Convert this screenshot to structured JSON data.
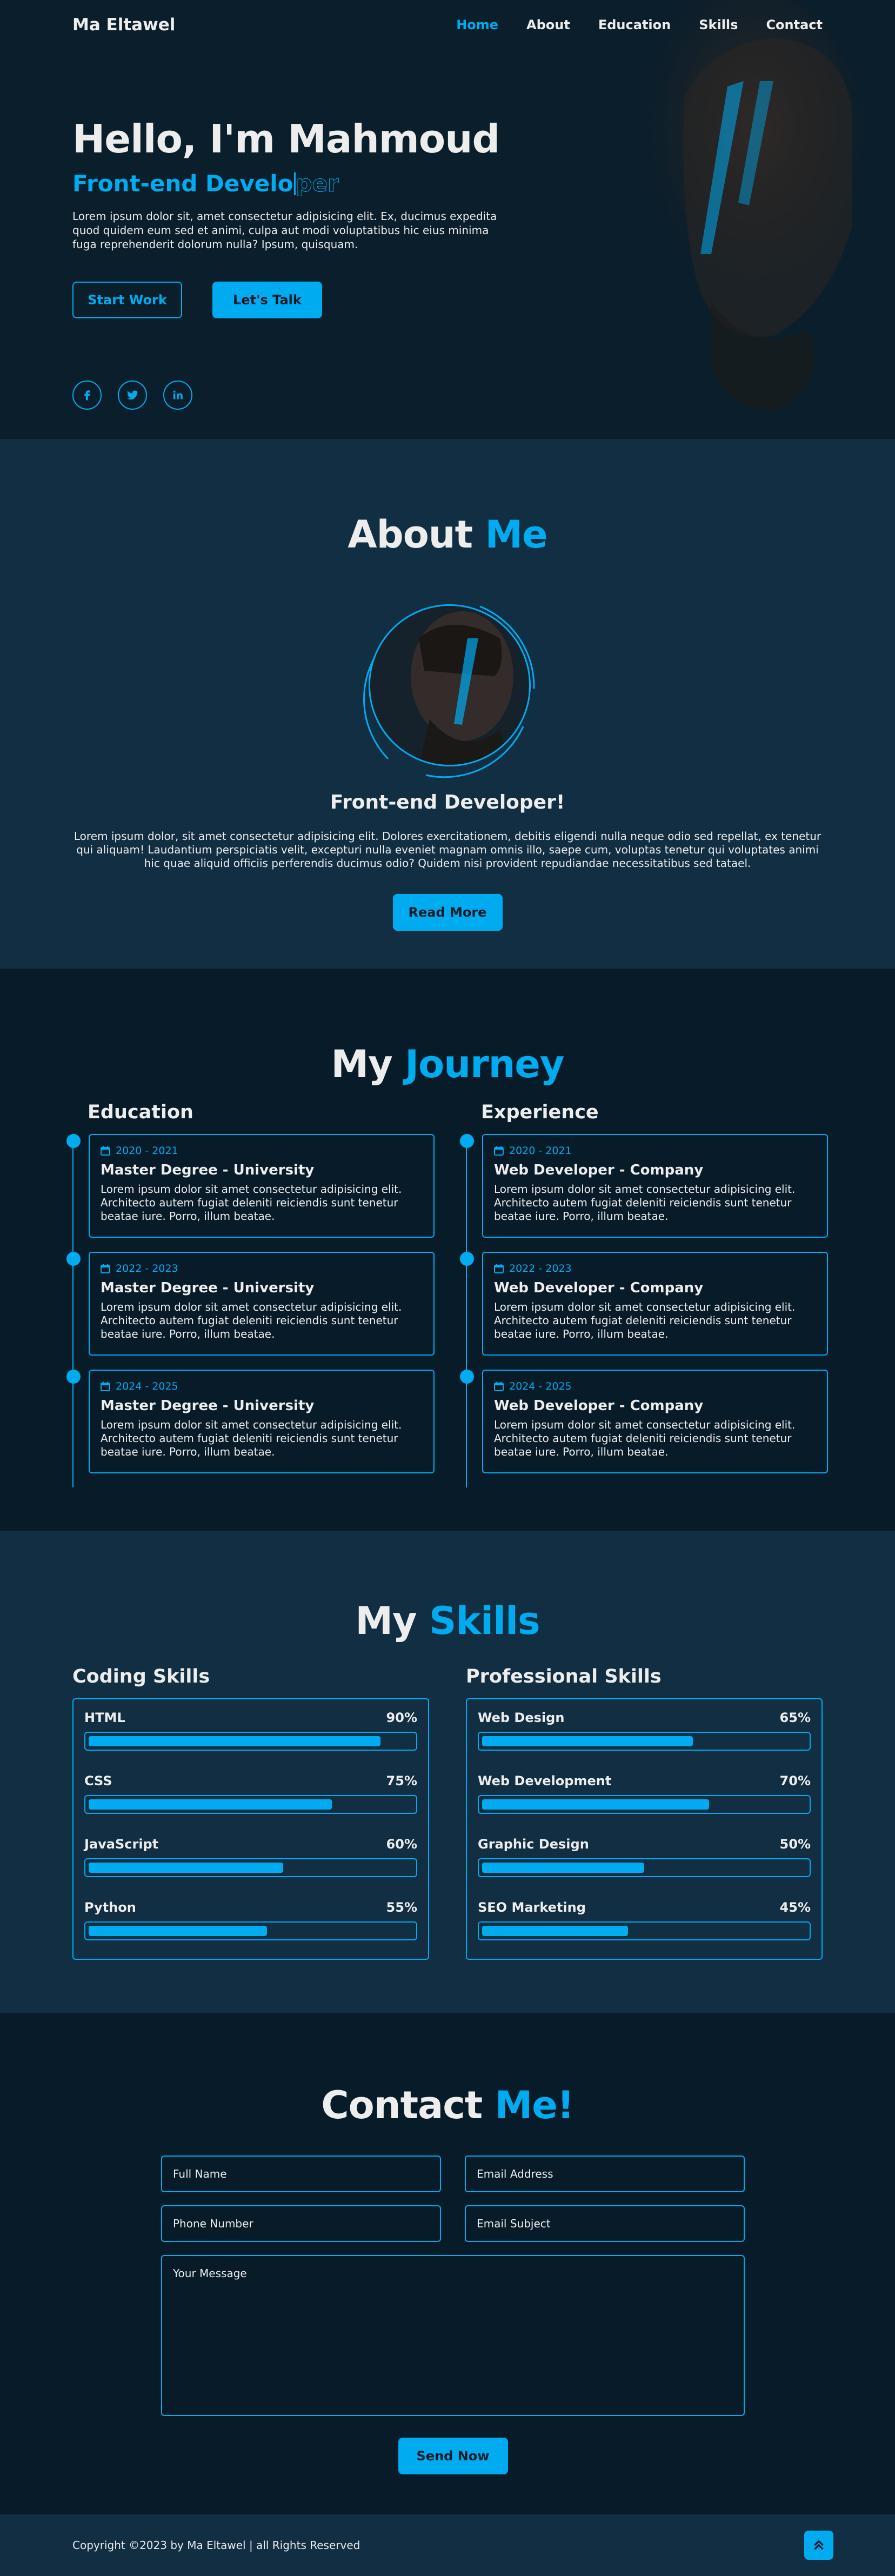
{
  "header": {
    "logo": "Ma Eltawel",
    "nav": [
      "Home",
      "About",
      "Education",
      "Skills",
      "Contact"
    ]
  },
  "hero": {
    "title": "Hello, I'm Mahmoud",
    "subtitle_typed": "Front-end Develo",
    "subtitle_rest": "per",
    "text": "Lorem ipsum dolor sit, amet consectetur adipisicing elit. Ex, ducimus expedita quod quidem eum sed et animi, culpa aut modi voluptatibus hic eius minima fuga reprehenderit dolorum nulla? Ipsum, quisquam.",
    "btn_primary": "Start Work",
    "btn_secondary": "Let's Talk",
    "socials": [
      "facebook-icon",
      "twitter-icon",
      "linkedin-icon"
    ]
  },
  "about": {
    "heading": "About",
    "heading_accent": "Me",
    "role": "Front-end Developer!",
    "text": "Lorem ipsum dolor, sit amet consectetur adipisicing elit. Dolores exercitationem, debitis eligendi nulla neque odio sed repellat, ex tenetur qui aliquam! Laudantium perspiciatis velit, excepturi nulla eveniet magnam omnis illo, saepe cum, voluptas tenetur qui voluptates animi hic quae aliquid officiis perferendis ducimus odio? Quidem nisi provident repudiandae necessitatibus sed tatael.",
    "button": "Read More"
  },
  "journey": {
    "heading": "My",
    "heading_accent": "Journey",
    "education": {
      "title": "Education",
      "items": [
        {
          "date": "2020 - 2021",
          "title": "Master Degree - University",
          "text": "Lorem ipsum dolor sit amet consectetur adipisicing elit. Architecto autem fugiat deleniti reiciendis sunt tenetur beatae iure. Porro, illum beatae."
        },
        {
          "date": "2022 - 2023",
          "title": "Master Degree - University",
          "text": "Lorem ipsum dolor sit amet consectetur adipisicing elit. Architecto autem fugiat deleniti reiciendis sunt tenetur beatae iure. Porro, illum beatae."
        },
        {
          "date": "2024 - 2025",
          "title": "Master Degree - University",
          "text": "Lorem ipsum dolor sit amet consectetur adipisicing elit. Architecto autem fugiat deleniti reiciendis sunt tenetur beatae iure. Porro, illum beatae."
        }
      ]
    },
    "experience": {
      "title": "Experience",
      "items": [
        {
          "date": "2020 - 2021",
          "title": "Web Developer - Company",
          "text": "Lorem ipsum dolor sit amet consectetur adipisicing elit. Architecto autem fugiat deleniti reiciendis sunt tenetur beatae iure. Porro, illum beatae."
        },
        {
          "date": "2022 - 2023",
          "title": "Web Developer - Company",
          "text": "Lorem ipsum dolor sit amet consectetur adipisicing elit. Architecto autem fugiat deleniti reiciendis sunt tenetur beatae iure. Porro, illum beatae."
        },
        {
          "date": "2024 - 2025",
          "title": "Web Developer - Company",
          "text": "Lorem ipsum dolor sit amet consectetur adipisicing elit. Architecto autem fugiat deleniti reiciendis sunt tenetur beatae iure. Porro, illum beatae."
        }
      ]
    }
  },
  "skills": {
    "heading": "My",
    "heading_accent": "Skills",
    "coding": {
      "title": "Coding Skills",
      "items": [
        {
          "name": "HTML",
          "value": "90%",
          "fraction": 0.9
        },
        {
          "name": "CSS",
          "value": "75%",
          "fraction": 0.75
        },
        {
          "name": "JavaScript",
          "value": "60%",
          "fraction": 0.6
        },
        {
          "name": "Python",
          "value": "55%",
          "fraction": 0.55
        }
      ]
    },
    "professional": {
      "title": "Professional Skills",
      "items": [
        {
          "name": "Web Design",
          "value": "65%",
          "fraction": 0.65
        },
        {
          "name": "Web Development",
          "value": "70%",
          "fraction": 0.7
        },
        {
          "name": "Graphic Design",
          "value": "50%",
          "fraction": 0.5
        },
        {
          "name": "SEO Marketing",
          "value": "45%",
          "fraction": 0.45
        }
      ]
    }
  },
  "contact": {
    "heading": "Contact",
    "heading_accent": "Me!",
    "full_name": "Full Name",
    "email": "Email Address",
    "phone": "Phone Number",
    "subject": "Email Subject",
    "message": "Your Message",
    "button": "Send Now"
  },
  "footer": {
    "copyright": "Copyright ©2023 by Ma Eltawel | all Rights Reserved"
  },
  "colors": {
    "accent": "#00abf0",
    "bg_dark": "#081b29",
    "bg_light": "#112e42",
    "text": "#ededed"
  }
}
